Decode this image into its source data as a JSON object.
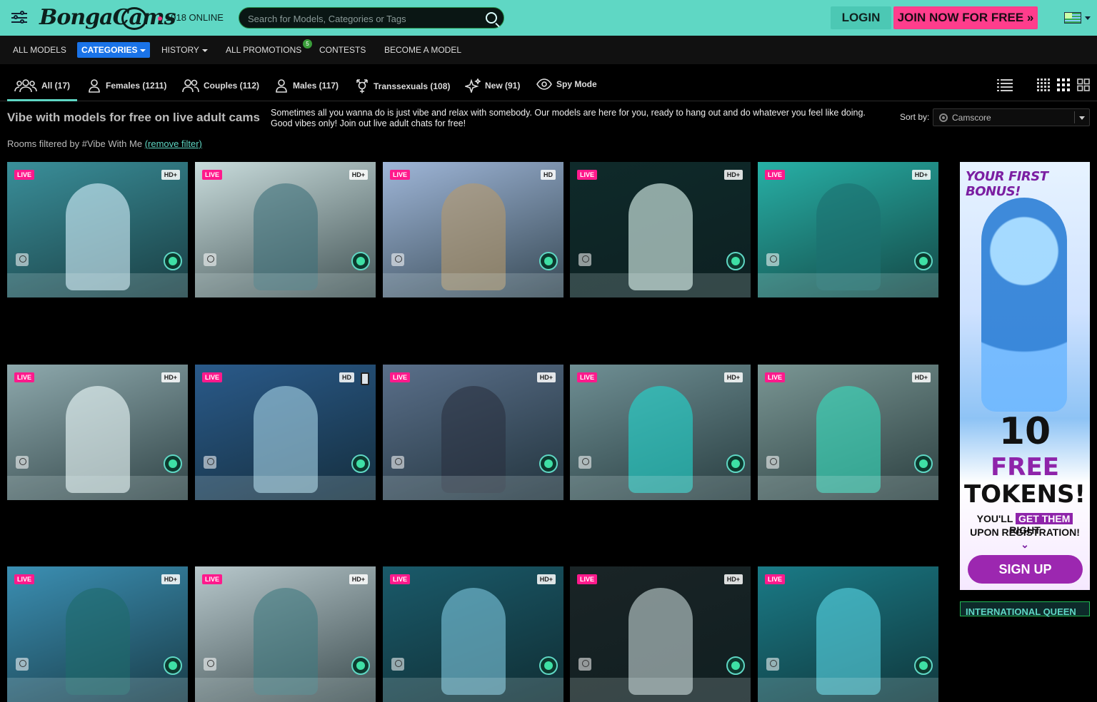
{
  "header": {
    "logo_text": "BongaCams",
    "online_count": "1918 ONLINE",
    "search_placeholder": "Search for Models, Categories or Tags",
    "login_label": "LOGIN",
    "join_label": "JOIN NOW FOR FREE »"
  },
  "nav": {
    "items": [
      {
        "label": "ALL MODELS"
      },
      {
        "label": "CATEGORIES"
      },
      {
        "label": "HISTORY"
      },
      {
        "label": "ALL PROMOTIONS"
      },
      {
        "label": "CONTESTS"
      },
      {
        "label": "BECOME A MODEL"
      }
    ],
    "promo_badge": "5"
  },
  "tabs": [
    {
      "label": "All (17)",
      "icon": "group-icon"
    },
    {
      "label": "Females (1211)",
      "icon": "female-icon"
    },
    {
      "label": "Couples (112)",
      "icon": "couple-icon"
    },
    {
      "label": "Males (117)",
      "icon": "male-icon"
    },
    {
      "label": "Transsexuals (108)",
      "icon": "transgender-icon"
    },
    {
      "label": "New (91)",
      "icon": "sparkle-icon"
    },
    {
      "label": "Spy Mode",
      "icon": "eye-icon"
    }
  ],
  "intro": {
    "title": "Vibe with models for free on live adult cams",
    "description": "Sometimes all you wanna do is just vibe and relax with somebody. Our models are here for you, ready to hang out and do whatever you feel like doing. Good vibes only! Join out live adult chats for free!",
    "sort_label": "Sort by:",
    "sort_value": "Camscore",
    "filter_text": "Rooms filtered by #Vibe With Me",
    "remove_filter": "(remove filter)"
  },
  "cards": [
    {
      "live": "LIVE",
      "quality": "HD+",
      "bg": "#3a8f9a",
      "fig": "#d8f4ff",
      "mobile": false
    },
    {
      "live": "LIVE",
      "quality": "HD+",
      "bg": "#c9dcdc",
      "fig": "#3d6f7a",
      "mobile": false
    },
    {
      "live": "LIVE",
      "quality": "HD",
      "bg": "#9fb6d8",
      "fig": "#b89a6a",
      "mobile": false
    },
    {
      "live": "LIVE",
      "quality": "HD+",
      "bg": "#0f2a2a",
      "fig": "#e6fff8",
      "mobile": false
    },
    {
      "live": "LIVE",
      "quality": "HD+",
      "bg": "#27b0a6",
      "fig": "#1d6f6f",
      "mobile": false
    },
    {
      "live": "LIVE",
      "quality": "HD+",
      "bg": "#8ea9ad",
      "fig": "#f2ffff",
      "mobile": false
    },
    {
      "live": "LIVE",
      "quality": "HD",
      "bg": "#2a5a8a",
      "fig": "#a9d6e8",
      "mobile": true
    },
    {
      "live": "LIVE",
      "quality": "HD+",
      "bg": "#5a6f8a",
      "fig": "#2a3040",
      "mobile": false
    },
    {
      "live": "LIVE",
      "quality": "HD+",
      "bg": "#6f8f94",
      "fig": "#22d8d0",
      "mobile": false
    },
    {
      "live": "LIVE",
      "quality": "HD+",
      "bg": "#7a9694",
      "fig": "#36e0c0",
      "mobile": false
    },
    {
      "live": "LIVE",
      "quality": "HD+",
      "bg": "#3b8fb3",
      "fig": "#1e6a6a",
      "mobile": false
    },
    {
      "live": "LIVE",
      "quality": "HD+",
      "bg": "#b8c8cc",
      "fig": "#3f7a80",
      "mobile": false
    },
    {
      "live": "LIVE",
      "quality": "HD+",
      "bg": "#1a5a6a",
      "fig": "#7fc8e0",
      "mobile": false
    },
    {
      "live": "LIVE",
      "quality": "HD+",
      "bg": "#1a2426",
      "fig": "#c8d8d8",
      "mobile": false
    },
    {
      "live": "LIVE",
      "quality": "",
      "bg": "#1a7a86",
      "fig": "#5ad8e8",
      "mobile": false
    }
  ],
  "ad": {
    "headline": "YOUR FIRST BONUS!",
    "amount": "10",
    "free": "FREE",
    "tokens": "TOKENS!",
    "line1_pre": "YOU'LL",
    "line1_hl": "GET THEM",
    "line1_post": "RIGHT",
    "line2": "UPON REGISTRATION!",
    "cta": "SIGN UP"
  },
  "ad2": {
    "text": "INTERNATIONAL QUEEN"
  },
  "colors": {
    "accent": "#5fd7c4",
    "join": "#ff3d8c",
    "live_badge": "#ff1a8c",
    "active_nav": "#1a73e8"
  }
}
